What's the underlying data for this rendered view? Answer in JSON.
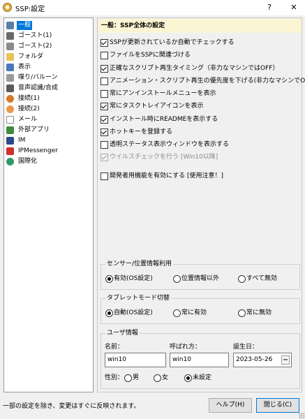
{
  "window": {
    "title": "SSP:設定",
    "help_glyph": "?",
    "close_glyph": "✕"
  },
  "sidebar": {
    "items": [
      {
        "label": "一般",
        "icon": "gear-icon",
        "color": "#5b7fa8",
        "selected": true
      },
      {
        "label": "ゴースト(1)",
        "icon": "ghost-icon",
        "color": "#6a6a6a"
      },
      {
        "label": "ゴースト(2)",
        "icon": "ghost-icon",
        "color": "#8a8a8a"
      },
      {
        "label": "フォルダ",
        "icon": "folder-icon",
        "color": "#e8c35a"
      },
      {
        "label": "表示",
        "icon": "monitor-icon",
        "color": "#4a78b8"
      },
      {
        "label": "喋り/バルーン",
        "icon": "balloon-icon",
        "color": "#9a9a9a"
      },
      {
        "label": "音声認識/合成",
        "icon": "speaker-icon",
        "color": "#5a5a5a"
      },
      {
        "label": "接続(1)",
        "icon": "network-icon",
        "color": "#d9792a"
      },
      {
        "label": "接続(2)",
        "icon": "network-icon",
        "color": "#e89a4a"
      },
      {
        "label": "メール",
        "icon": "mail-icon",
        "color": "#c9c9c9"
      },
      {
        "label": "外部アプリ",
        "icon": "app-window-icon",
        "color": "#3d8c3d"
      },
      {
        "label": "IM",
        "icon": "im-icon",
        "color": "#2a4a8a"
      },
      {
        "label": "IPMessenger",
        "icon": "ipmessenger-icon",
        "color": "#d03030"
      },
      {
        "label": "国際化",
        "icon": "globe-icon",
        "color": "#2e9a6a"
      }
    ]
  },
  "main": {
    "header": "一般：SSP全体の設定",
    "checkboxes": [
      {
        "label": "SSPが更新されているか自動でチェックする",
        "checked": true,
        "enabled": true
      },
      {
        "label": "ファイルをSSPに関連づける",
        "checked": false,
        "enabled": true
      },
      {
        "label": "正確なスクリプト再生タイミング（非力なマシンではOFF）",
        "checked": true,
        "enabled": true
      },
      {
        "label": "アニメーション・スクリプト再生の優先度を下げる(非力なマシンでON)",
        "checked": false,
        "enabled": true
      },
      {
        "label": "常にアンインストールメニューを表示",
        "checked": false,
        "enabled": true
      },
      {
        "label": "常にタスクトレイアイコンを表示",
        "checked": true,
        "enabled": true
      },
      {
        "label": "インストール時にREADMEを表示する",
        "checked": true,
        "enabled": true
      },
      {
        "label": "ホットキーを登録する",
        "checked": true,
        "enabled": true
      },
      {
        "label": "透明ステータス表示ウィンドウを表示する",
        "checked": false,
        "enabled": true
      },
      {
        "label": "ウイルスチェックを行う [Win10以降]",
        "checked": true,
        "enabled": false
      },
      {
        "label": "開発者用機能を有効にする [使用注意！]",
        "checked": false,
        "enabled": true
      }
    ],
    "sensor": {
      "title": "センサー/位置情報利用",
      "options": [
        "有効(OS設定)",
        "位置情報以外",
        "すべて無効"
      ],
      "selected": 0
    },
    "tablet": {
      "title": "タブレットモード切替",
      "options": [
        "自動(OS設定)",
        "常に有効",
        "常に無効"
      ],
      "selected": 0
    },
    "user": {
      "title": "ユーザ情報",
      "name_label": "名前：",
      "name_value": "win10",
      "nickname_label": "呼ばれ方：",
      "nickname_value": "win10",
      "birthday_label": "誕生日：",
      "birthday_value": "2023-05-26",
      "gender_label": "性別：",
      "gender_options": [
        "男",
        "女",
        "未設定"
      ],
      "gender_selected": 2
    }
  },
  "footer": {
    "status": "一部の設定を除き、変更はすぐに反映されます。",
    "help_button": "ヘルプ(H)",
    "close_button": "閉じる(C)"
  }
}
